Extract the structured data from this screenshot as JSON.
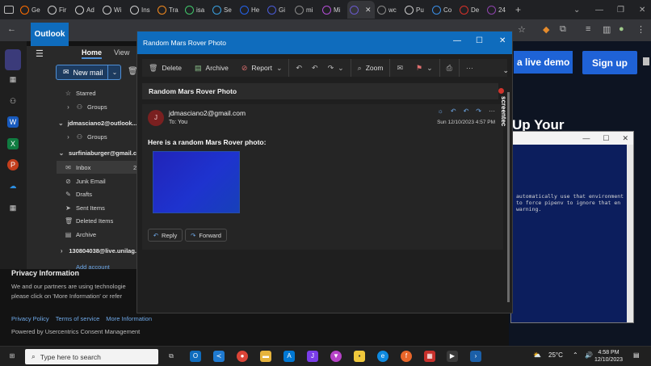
{
  "browser": {
    "tabs": [
      {
        "label": "Ge",
        "color": "#ff6d00"
      },
      {
        "label": "Fir",
        "color": "#cccccc"
      },
      {
        "label": "Ad",
        "color": "#cccccc"
      },
      {
        "label": "Wi",
        "color": "#cccccc"
      },
      {
        "label": "Ins",
        "color": "#cccccc"
      },
      {
        "label": "Tra",
        "color": "#f28a1f"
      },
      {
        "label": "isa",
        "color": "#41c66b"
      },
      {
        "label": "Se",
        "color": "#3aa0e0"
      },
      {
        "label": "He",
        "color": "#2563eb"
      },
      {
        "label": "Gi",
        "color": "#4a5bd6"
      },
      {
        "label": "mi",
        "color": "#888888"
      },
      {
        "label": "Mi",
        "color": "#b44ed6"
      },
      {
        "label": "",
        "color": "#6a5acd"
      },
      {
        "label": "wc",
        "color": "#888888"
      },
      {
        "label": "Pu",
        "color": "#cccccc"
      },
      {
        "label": "Co",
        "color": "#3a8ee6"
      },
      {
        "label": "De",
        "color": "#d7312a"
      },
      {
        "label": "24",
        "color": "#8e44ad"
      }
    ],
    "new_tab": "+",
    "site": {
      "demo_label": "a live demo",
      "signup_label": "Sign up",
      "hero_text": "Up Your",
      "privacy_title": "Privacy Information",
      "privacy_text_1": "We and our partners are using technologie",
      "privacy_text_2": "please click on 'More Information' or refer",
      "links": [
        "Privacy Policy",
        "Terms of service",
        "More Information"
      ],
      "powered_by": "Powered by Usercentrics Consent Management"
    }
  },
  "terminal": {
    "lines": [
      "automatically use that environment",
      "to force pipenv to ignore that en",
      "warning."
    ]
  },
  "outlook": {
    "brand": "Outlook",
    "tabs": {
      "home": "Home",
      "view": "View"
    },
    "new_mail": "New mail",
    "folders": [
      {
        "label": "Starred",
        "icon": "☆",
        "kind": "folder"
      },
      {
        "label": "Groups",
        "icon": "⚇",
        "kind": "group"
      },
      {
        "label": "jdmasciano2@outlook...",
        "icon": "",
        "kind": "acct"
      },
      {
        "label": "Groups",
        "icon": "⚇",
        "kind": "group"
      },
      {
        "label": "surfiniaburger@gmail.c",
        "icon": "",
        "kind": "acct"
      },
      {
        "label": "Inbox",
        "icon": "✉",
        "kind": "selected",
        "count": "2"
      },
      {
        "label": "Junk Email",
        "icon": "⊘",
        "kind": "folder"
      },
      {
        "label": "Drafts",
        "icon": "✎",
        "kind": "folder"
      },
      {
        "label": "Sent Items",
        "icon": "➤",
        "kind": "folder"
      },
      {
        "label": "Deleted Items",
        "icon": "🗑",
        "kind": "folder"
      },
      {
        "label": "Archive",
        "icon": "▤",
        "kind": "folder"
      },
      {
        "label": "130804038@live.unilag.",
        "icon": "",
        "kind": "acct"
      },
      {
        "label": "Add account",
        "icon": "",
        "kind": "link"
      }
    ]
  },
  "popup": {
    "title": "Random Mars Rover Photo",
    "toolbar": {
      "delete": "Delete",
      "archive": "Archive",
      "report": "Report",
      "zoom": "Zoom"
    },
    "subject": "Random Mars Rover Photo",
    "avatar_initial": "J",
    "sender": "jdmasciano2@gmail.com",
    "to_label": "To:",
    "to_value": "You",
    "date": "Sun 12/10/2023 4:57 PM",
    "body": "Here is a random Mars Rover photo:",
    "reply": "Reply",
    "forward": "Forward",
    "side_label": "screentec"
  },
  "taskbar": {
    "search_placeholder": "Type here to search",
    "temperature": "25°C",
    "time": "4:58 PM",
    "date": "12/10/2023"
  }
}
